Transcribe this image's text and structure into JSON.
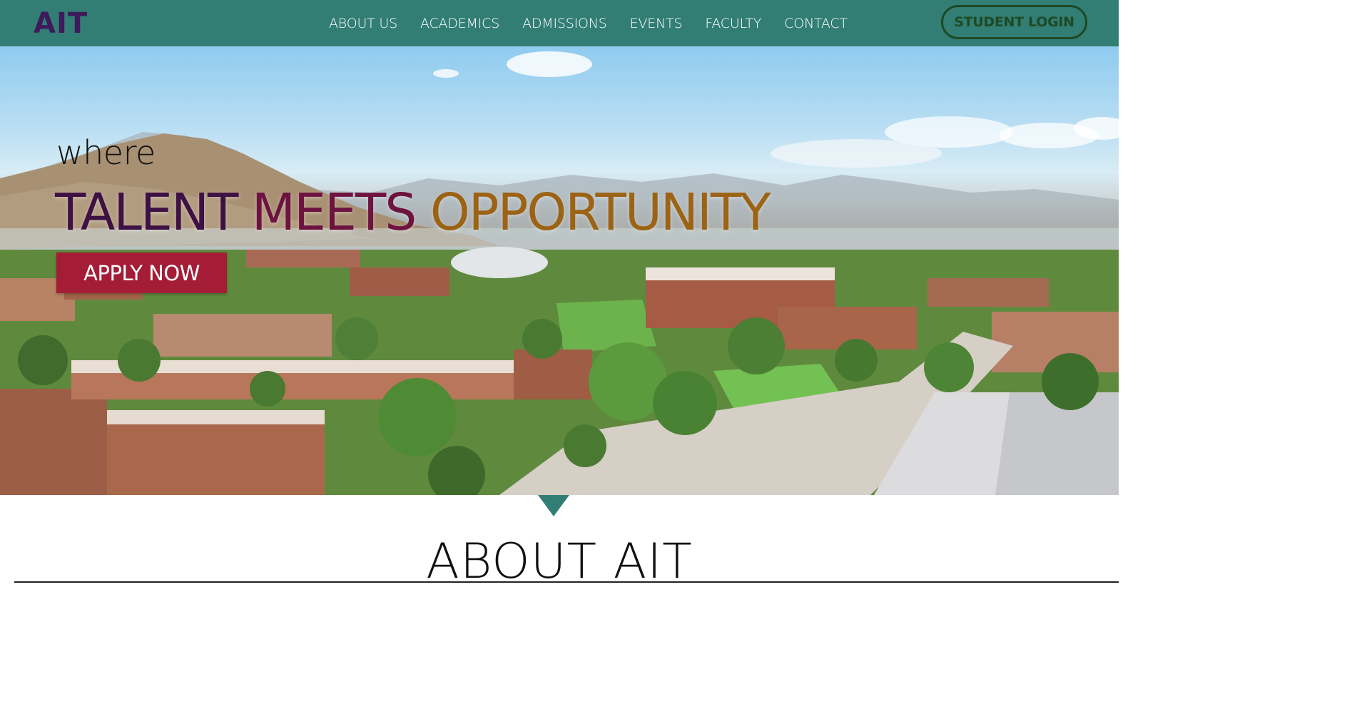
{
  "brand": {
    "logo_text": "AIT",
    "primary_color": "#327e75",
    "logo_color": "#3e1a5a"
  },
  "nav": {
    "items": [
      {
        "label": "ABOUT US"
      },
      {
        "label": "ACADEMICS"
      },
      {
        "label": "ADMISSIONS"
      },
      {
        "label": "EVENTS"
      },
      {
        "label": "FACULTY"
      },
      {
        "label": "CONTACT"
      }
    ],
    "login_label": "STUDENT LOGIN"
  },
  "hero": {
    "eyebrow": "where",
    "headline_part1": "TALENT",
    "headline_part2": "MEETS",
    "headline_part3": "OPPORTUNITY",
    "cta_label": "APPLY NOW",
    "cta_color": "#a41c36",
    "image_icon": "campus-aerial-photo"
  },
  "about": {
    "heading": "ABOUT AIT",
    "scroll_icon": "down-triangle-icon"
  }
}
